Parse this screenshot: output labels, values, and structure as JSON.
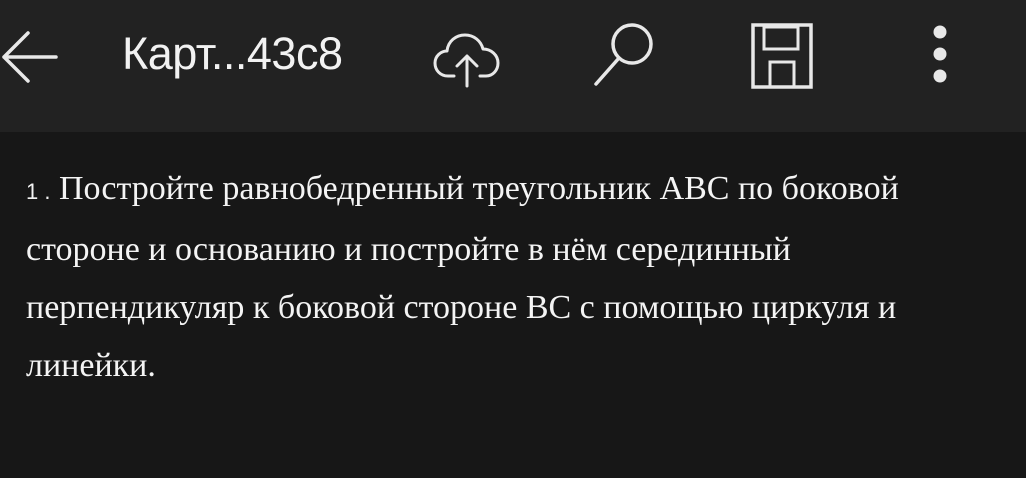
{
  "toolbar": {
    "title": "Карт...43с8",
    "icons": {
      "back": "arrow-left-icon",
      "upload": "cloud-upload-icon",
      "search": "search-icon",
      "save": "save-icon",
      "menu": "more-vertical-icon"
    },
    "background": "#222222"
  },
  "document": {
    "task_number": "1 .",
    "text": "Постройте равнобедренный треугольник ABC по боковой стороне и основанию и постройте в нём серединный перпендикуляр к боковой стороне BC с помощью циркуля и линейки.",
    "background": "#171717",
    "text_color": "#f4f4f4"
  }
}
